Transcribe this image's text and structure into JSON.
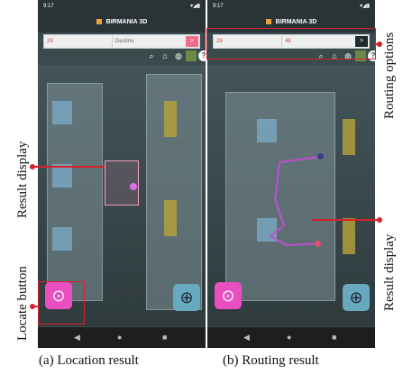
{
  "statusbar": {
    "time": "9:17",
    "indicators": "▾◢▮"
  },
  "app": {
    "title": "BIRMANIA 3D"
  },
  "screen_a": {
    "origin_value": "28",
    "dest_placeholder": "Destino",
    "go_label": ">"
  },
  "screen_b": {
    "origin_value": "28",
    "dest_value": "48",
    "go_label": ">"
  },
  "tools": {
    "search": "⌕",
    "home": "⌂",
    "globe": "◍",
    "help": "?"
  },
  "fab": {
    "locate": "⊙",
    "zoom": "⊕"
  },
  "nav": {
    "back": "◀",
    "home": "●",
    "recent": "■"
  },
  "annotations": {
    "result_display": "Result display",
    "locate_button": "Locate button",
    "routing_options": "Routing options"
  },
  "captions": {
    "a": "(a) Location result",
    "b": "(b) Routing result"
  },
  "colors": {
    "highlight": "#d8212b",
    "locate_fab": "#e94fbf",
    "zoom_fab": "#68a9c0"
  }
}
